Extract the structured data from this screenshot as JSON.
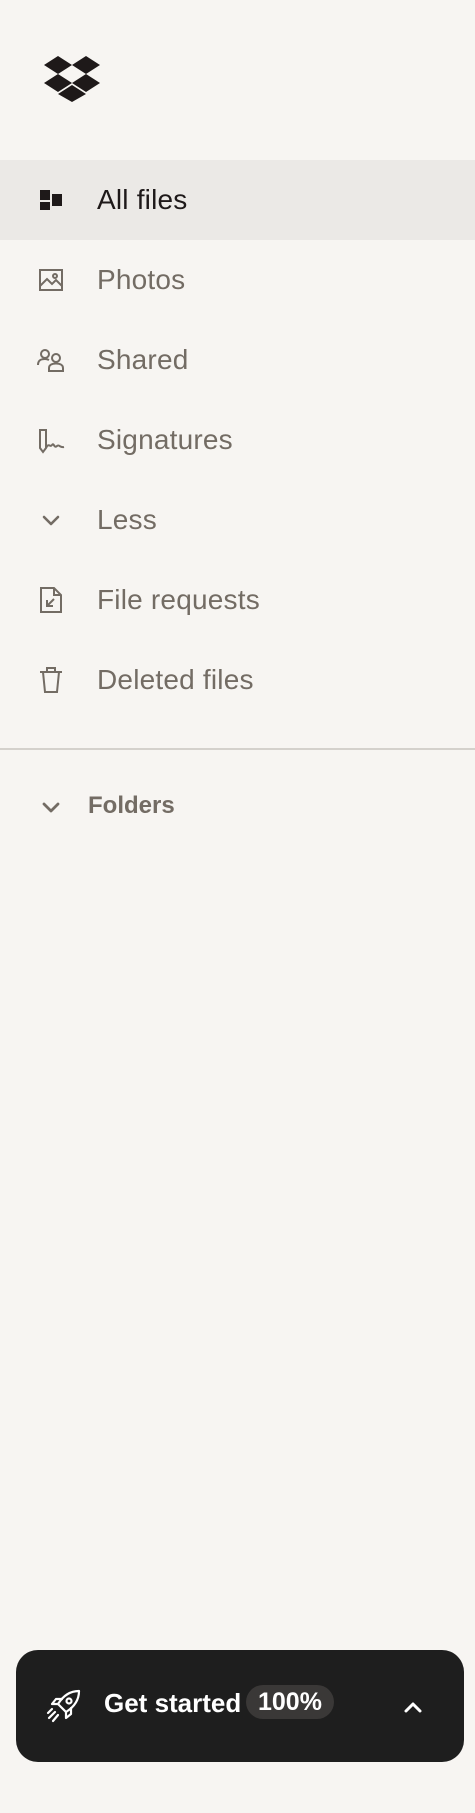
{
  "app": {
    "logo_icon": "dropbox-logo-icon"
  },
  "nav": {
    "items": [
      {
        "label": "All files",
        "icon": "all-files-icon",
        "active": true
      },
      {
        "label": "Photos",
        "icon": "photo-icon",
        "active": false
      },
      {
        "label": "Shared",
        "icon": "shared-people-icon",
        "active": false
      },
      {
        "label": "Signatures",
        "icon": "signature-pen-icon",
        "active": false
      },
      {
        "label": "Less",
        "icon": "chevron-down-icon",
        "active": false
      },
      {
        "label": "File requests",
        "icon": "file-request-icon",
        "active": false
      },
      {
        "label": "Deleted files",
        "icon": "trash-icon",
        "active": false
      }
    ]
  },
  "folders": {
    "label": "Folders",
    "icon": "chevron-down-icon"
  },
  "get_started": {
    "label": "Get started",
    "progress": "100%",
    "icon": "rocket-icon",
    "toggle_icon": "chevron-up-icon"
  },
  "colors": {
    "background": "#f7f5f2",
    "active_item": "#ebe9e6",
    "text_primary": "#1e1919",
    "text_secondary": "#736c64",
    "panel_dark": "#1e1e1e"
  }
}
